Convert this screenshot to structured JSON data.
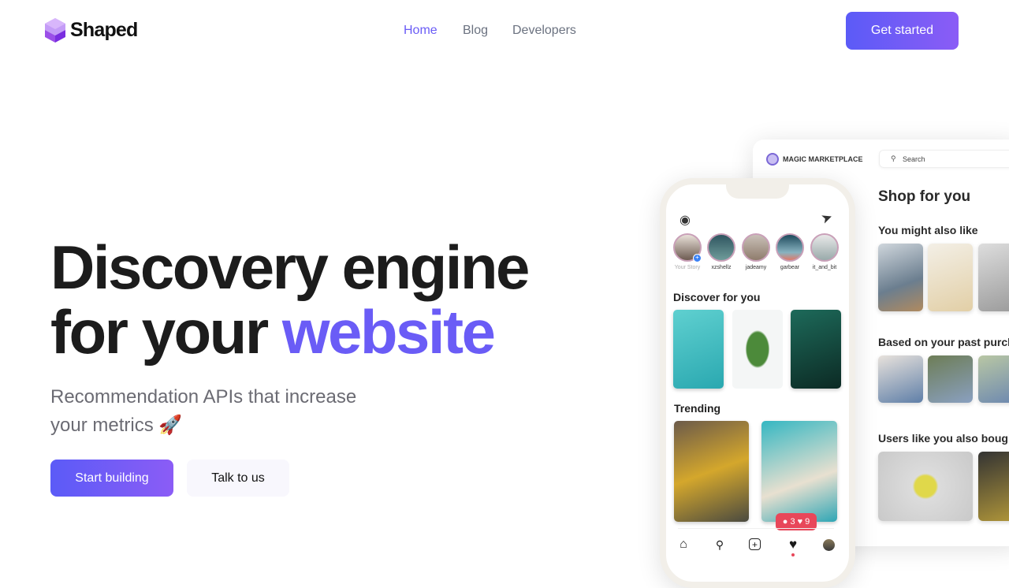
{
  "header": {
    "brand": "Shaped",
    "nav": [
      "Home",
      "Blog",
      "Developers"
    ],
    "cta": "Get started",
    "accent": "#6a5cf6"
  },
  "hero": {
    "title_line1": "Discovery engine",
    "title_line2_prefix": "for your",
    "title_accent": "website",
    "subtitle": "Recommendation APIs that increase your metrics 🚀",
    "primary_button": "Start building",
    "secondary_button": "Talk to us"
  },
  "marketplace": {
    "brand": "MAGIC MARKETPLACE",
    "search_placeholder": "Search",
    "title": "Shop for you",
    "sections": [
      "You might also like",
      "Based on your past purcha",
      "Users like you also bought"
    ]
  },
  "phone": {
    "stories": [
      "Your Story",
      "xzshellz",
      "jadeamy",
      "garbear",
      "it_and_bit"
    ],
    "discover_title": "Discover for you",
    "trending_title": "Trending",
    "notif_comments": "3",
    "notif_likes": "9"
  }
}
